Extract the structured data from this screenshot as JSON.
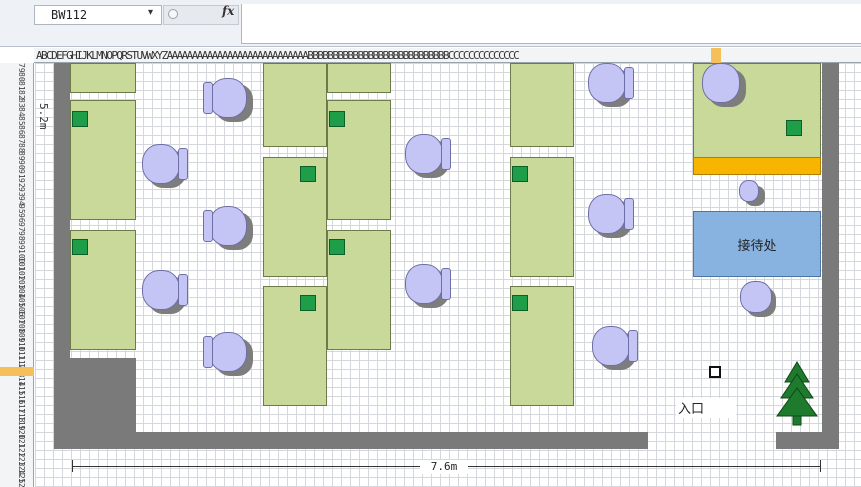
{
  "toolbar": {
    "name_box": "BW112",
    "fx_label": "fx",
    "formula": ""
  },
  "sheet": {
    "column_header_text": "ABCDEFGHIJKLMNOPQRSTUVWXYZAAAAAAAAAAAAAAAAAAAAAAAAAAAABBBBBBBBBBBBBBBBBBBBBBBBBBBBCCCCCCCCCCCCCC",
    "row_numbers": [
      "79",
      "80",
      "81",
      "82",
      "83",
      "84",
      "85",
      "86",
      "87",
      "88",
      "89",
      "90",
      "91",
      "92",
      "93",
      "94",
      "95",
      "96",
      "97",
      "98",
      "99",
      "100",
      "101",
      "102",
      "103",
      "104",
      "105",
      "106",
      "107",
      "108",
      "109",
      "110",
      "111",
      "112",
      "113",
      "114",
      "115",
      "116",
      "117",
      "118",
      "119",
      "120",
      "121",
      "122",
      "123",
      "124",
      "125",
      "126"
    ],
    "selected_row": "112"
  },
  "floorplan": {
    "reception_label": "接待处",
    "entrance_label": "入口",
    "width_dimension": "7.6m",
    "height_dimension": "5.2m"
  }
}
